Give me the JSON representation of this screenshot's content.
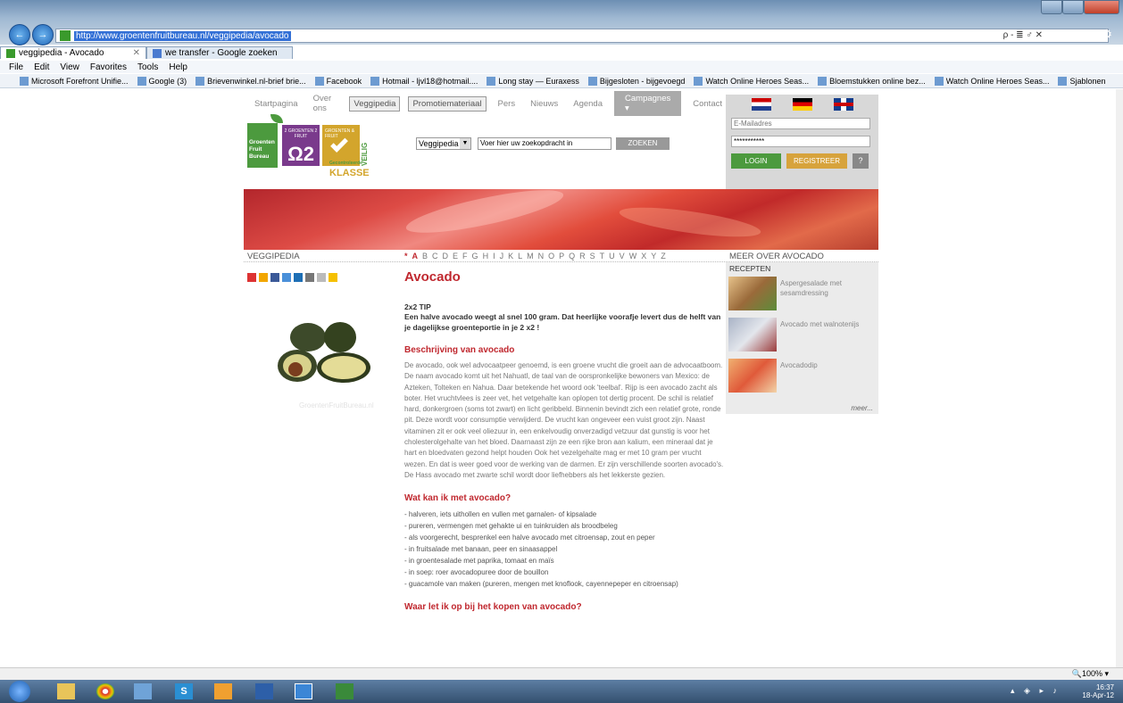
{
  "browser": {
    "url": "http://www.groentenfruitbureau.nl/veggipedia/avocado",
    "addr_tools": "ρ - ≣ ♂ ✕",
    "tabs": [
      {
        "label": "veggipedia - Avocado",
        "close": "✕"
      },
      {
        "label": "we transfer - Google zoeken"
      }
    ],
    "menu": [
      "File",
      "Edit",
      "View",
      "Favorites",
      "Tools",
      "Help"
    ],
    "favorites": [
      "Microsoft Forefront Unifie...",
      "Google (3)",
      "Brievenwinkel.nl-brief brie...",
      "Facebook",
      "Hotmail - ljvl18@hotmail....",
      "Long stay — Euraxess",
      "Bijgesloten - bijgevoegd",
      "Watch Online Heroes Seas...",
      "Bloemstukken online bez...",
      "Watch Online Heroes Seas...",
      "Sjablonen"
    ],
    "zoom": "100%",
    "clock_time": "16:37",
    "clock_date": "18-Apr-12"
  },
  "site": {
    "nav": [
      "Startpagina",
      "Over ons",
      "Veggipedia",
      "Promotiemateriaal",
      "Pers",
      "Nieuws",
      "Agenda"
    ],
    "campaign": "Campagnes ▾",
    "contact": "Contact",
    "logo_text": "Groenten Fruit Bureau",
    "logo_2x2_top": "2 GROENTEN 2 FRUIT",
    "logo_2x2": "Ω2",
    "logo_veilig_top": "GROENTEN & FRUIT",
    "logo_veilig": "VEILIG",
    "logo_klasse_small": "Gecontroleerde",
    "logo_klasse": "KLASSE",
    "search_select": "Veggipedia",
    "search_placeholder": "Voer hier uw zoekopdracht in",
    "search_button": "ZOEKEN",
    "email_placeholder": "E-Mailadres",
    "password_value": "***********",
    "login": "LOGIN",
    "register": "REGISTREER",
    "help": "?"
  },
  "section": {
    "left": "VEGGIPEDIA",
    "letters": [
      "*",
      "A",
      "B",
      "C",
      "D",
      "E",
      "F",
      "G",
      "H",
      "I",
      "J",
      "K",
      "L",
      "M",
      "N",
      "O",
      "P",
      "Q",
      "R",
      "S",
      "T",
      "U",
      "V",
      "W",
      "X",
      "Y",
      "Z"
    ],
    "right": "MEER OVER AVOCADO"
  },
  "article": {
    "title": "Avocado",
    "tip_title": "2x2 TIP",
    "tip": "Een halve avocado weegt al snel 100 gram. Dat heerlijke voorafje levert dus de helft van je dagelijkse groenteportie in je 2 x2 !",
    "desc_title": "Beschrijving van avocado",
    "desc": "De avocado, ook wel advocaatpeer genoemd, is een groene vrucht die groeit aan de advocaatboom. De naam avocado komt uit het Nahuatl, de taal van de oorspronkelijke bewoners van Mexico: de Azteken, Tolteken en Nahua. Daar betekende het woord ook 'teelbal'. Rijp is een avocado zacht als boter. Het vruchtvlees is zeer vet, het vetgehalte kan oplopen tot dertig procent. De schil is relatief hard, donkergroen (soms tot zwart) en licht geribbeld. Binnenin bevindt zich een relatief grote, ronde pit. Deze wordt voor consumptie verwijderd. De vrucht kan ongeveer een vuist groot zijn. Naast vitaminen zit er ook veel oliezuur in, een enkelvoudig onverzadigd vetzuur dat gunstig is voor het cholesterolgehalte van het bloed. Daarnaast zijn ze een rijke bron aan kalium, een mineraal dat je hart en bloedvaten gezond helpt houden Ook het vezelgehalte mag er met 10 gram per vrucht wezen. En dat is weer goed voor de werking van de darmen. Er zijn verschillende soorten avocado's. De Hass avocado met zwarte schil wordt door liefhebbers als het lekkerste gezien.",
    "use_title": "Wat kan ik met avocado?",
    "uses": [
      "- halveren, iets uithollen en vullen met garnalen- of kipsalade",
      "- pureren, vermengen met gehakte ui en tuinkruiden als broodbeleg",
      "- als voorgerecht, besprenkel een halve avocado met citroensap, zout en peper",
      "- in fruitsalade met banaan, peer en sinaasappel",
      "- in groentesalade met paprika, tomaat en maïs",
      "- in soep: roer avocadopuree door de bouillon",
      "- guacamole van maken (pureren, mengen met knoflook, cayennepeper en citroensap)"
    ],
    "buy_title": "Waar let ik op bij het kopen van avocado?",
    "watermark": "GroentenFruitBureau.nl"
  },
  "sidebar": {
    "title": "RECEPTEN",
    "recipes": [
      {
        "name": "Aspergesalade met sesamdressing"
      },
      {
        "name": "Avocado met walnotenijs"
      },
      {
        "name": "Avocadodip"
      }
    ],
    "more": "meer..."
  }
}
